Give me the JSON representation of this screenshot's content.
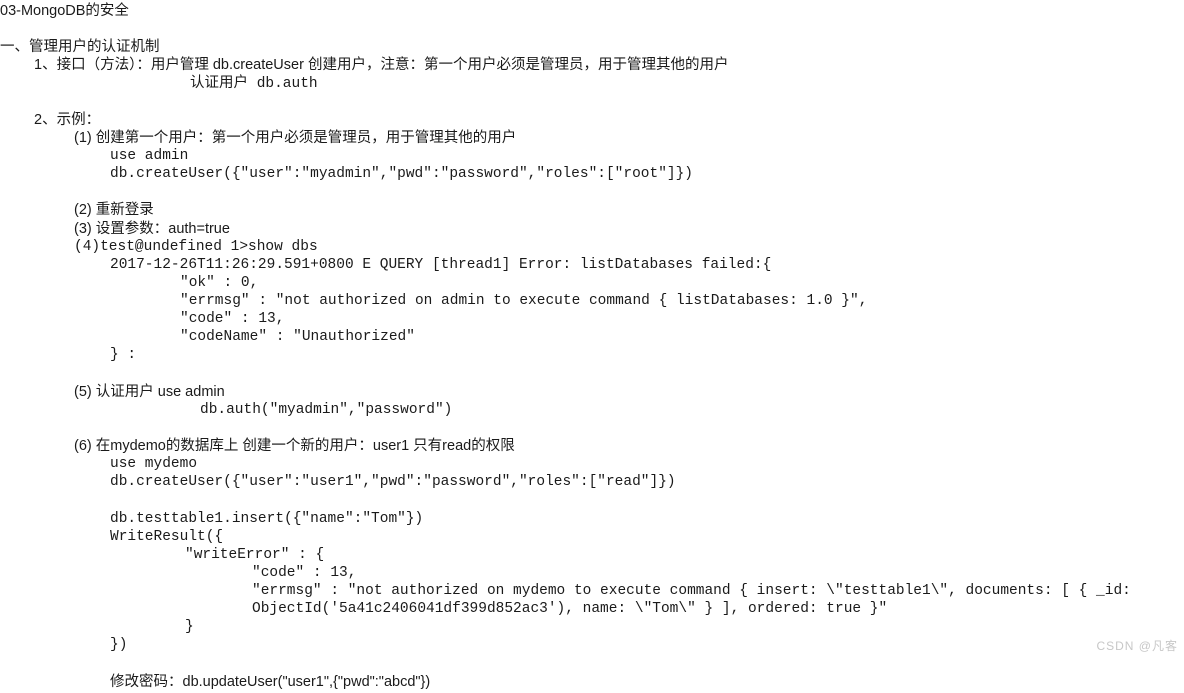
{
  "title": "03-MongoDB的安全",
  "section1_heading": "一、管理用户的认证机制",
  "line1a": "1、接口（方法）：用户管理  db.createUser 创建用户，注意：第一个用户必须是管理员，用于管理其他的用户",
  "line1b": "认证用户  db.auth",
  "line2": "2、示例：",
  "ex1_title": "(1) 创建第一个用户：第一个用户必须是管理员，用于管理其他的用户",
  "ex1_cursor_note": "I",
  "ex1_l2": "use admin",
  "ex1_l3": "db.createUser({\"user\":\"myadmin\",\"pwd\":\"password\",\"roles\":[\"root\"]})",
  "ex2": "(2) 重新登录",
  "ex3": "(3) 设置参数：auth=true",
  "ex4_l1": "(4)test@undefined 1>show dbs",
  "ex4_l2": "2017-12-26T11:26:29.591+0800 E QUERY    [thread1] Error: listDatabases failed:{",
  "ex4_l3": "\"ok\" : 0,",
  "ex4_l4": "\"errmsg\" : \"not authorized on admin to execute command { listDatabases: 1.0 }\",",
  "ex4_l5": "\"code\" : 13,",
  "ex4_l6": "\"codeName\" : \"Unauthorized\"",
  "ex4_l7": "} :",
  "ex5_l1": "(5) 认证用户  use admin",
  "ex5_l2": "db.auth(\"myadmin\",\"password\")",
  "ex6_l1": "(6) 在mydemo的数据库上  创建一个新的用户：user1  只有read的权限",
  "ex6_l2": "use mydemo",
  "ex6_l3": "db.createUser({\"user\":\"user1\",\"pwd\":\"password\",\"roles\":[\"read\"]})",
  "ex6_l4": "db.testtable1.insert({\"name\":\"Tom\"})",
  "ex6_l5": "WriteResult({",
  "ex6_l6": "\"writeError\" : {",
  "ex6_l7": "\"code\" : 13,",
  "ex6_l8": "\"errmsg\" : \"not authorized on mydemo to execute command { insert: \\\"testtable1\\\", documents: [ { _id:",
  "ex6_l8b": "ObjectId('5a41c2406041df399d852ac3'), name: \\\"Tom\\\" } ], ordered: true }\"",
  "ex6_l9": "}",
  "ex6_l10": "})",
  "ex6_pwd": "修改密码：db.updateUser(\"user1\",{\"pwd\":\"abcd\"})",
  "watermark": "CSDN @凡客"
}
